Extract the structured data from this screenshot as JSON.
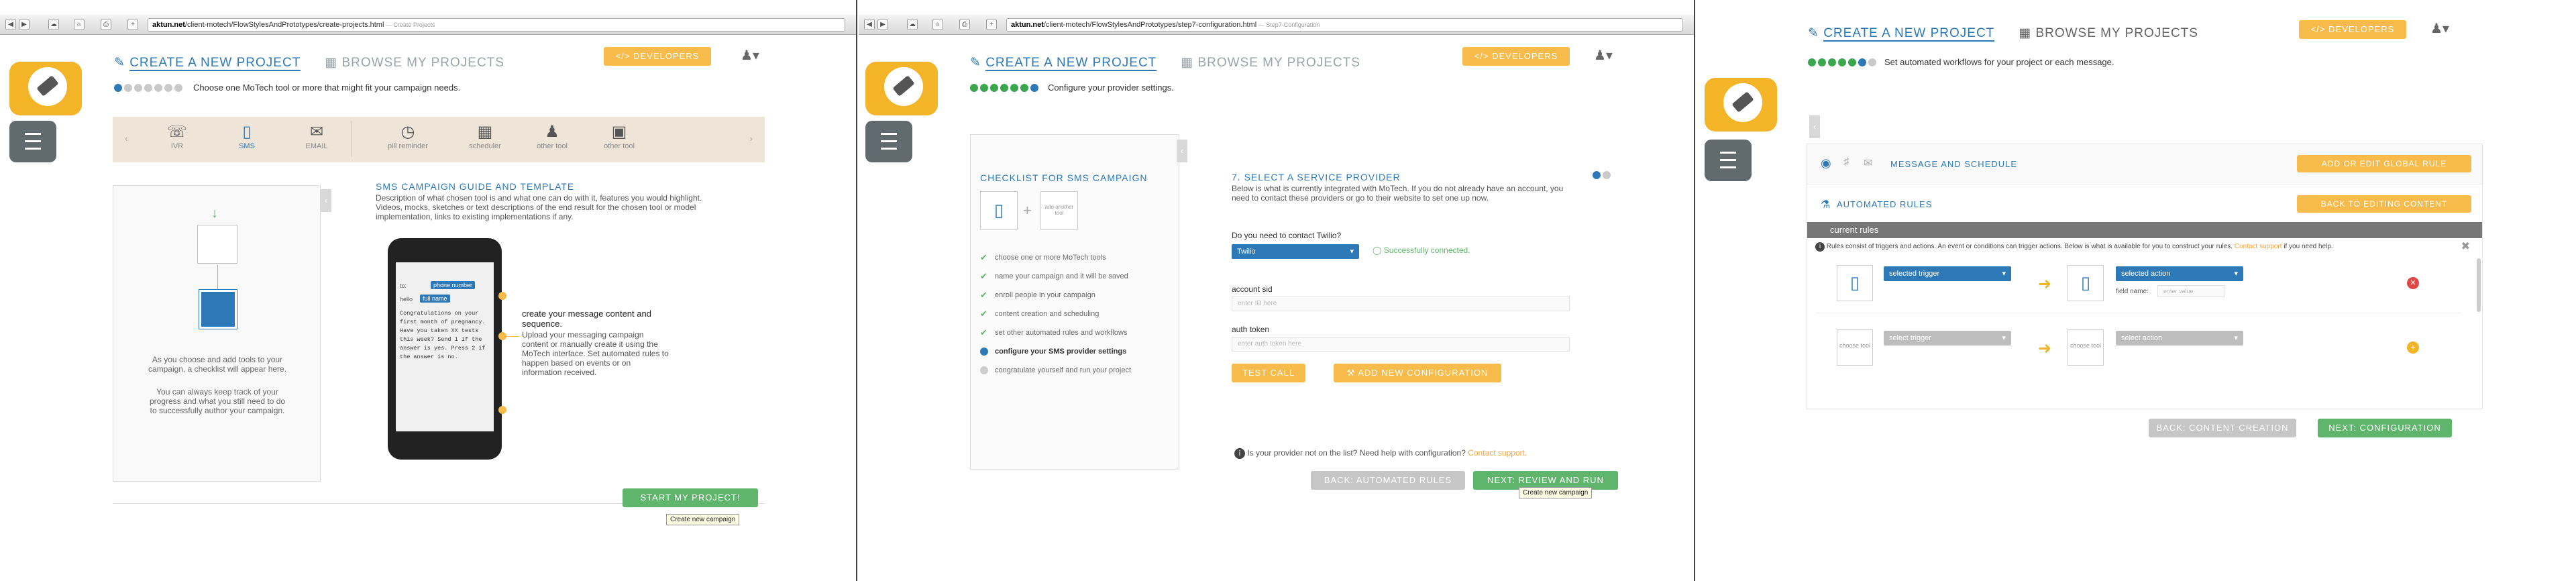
{
  "common": {
    "create_tab": "CREATE A NEW PROJECT",
    "browse_tab": "BROWSE MY PROJECTS",
    "developers": "</> DEVELOPERS",
    "browser_nav": [
      "◀",
      "▶",
      "☁",
      "⌂",
      "⎙",
      "+"
    ]
  },
  "p1": {
    "url_host": "aktun.net",
    "url_path": "/client-motech/FlowStylesAndPrototypes/create-projects.html",
    "url_title": " — Create Projects",
    "subtitle": "Choose one MoTech tool or more that might fit your campaign needs.",
    "tools": [
      {
        "label": "IVR",
        "icon": "phone-volume-icon"
      },
      {
        "label": "SMS",
        "icon": "sms-icon"
      },
      {
        "label": "EMAIL",
        "icon": "envelope-icon"
      },
      {
        "label": "pill reminder",
        "icon": "clock-icon"
      },
      {
        "label": "scheduler",
        "icon": "calendar-icon"
      },
      {
        "label": "other tool",
        "icon": "person-icon"
      },
      {
        "label": "other tool",
        "icon": "briefcase-icon"
      }
    ],
    "checklist_hint1": "As you choose and add tools to your campaign, a checklist will appear here.",
    "checklist_hint2": "You can always keep track of your progress and what you still need to do to successfully author your campaign.",
    "guide_title": "SMS CAMPAIGN GUIDE AND TEMPLATE",
    "guide_text": "Description of what chosen tool is and what one can do with it, features you would highlight. Videos, mocks, sketches or text descriptions of the end result for the chosen tool or model implementation, links to existing implementations if any.",
    "phone_tags": [
      "phone number",
      "full name"
    ],
    "phone_text": "Congratulations on your first month of pregnancy. Have you taken XX tests this week? Send 1 if the answer is yes. Press 2 if the answer is no.",
    "callout_title": "create your message content and sequence.",
    "callout_text": "Upload your messaging campaign content or manually create it using the MoTech interface. Set automated rules to happen based on events or on information received.",
    "start_button": "START MY PROJECT!",
    "tooltip": "Create new campaign"
  },
  "p2": {
    "url_host": "aktun.net",
    "url_path": "/client-motech/FlowStylesAndPrototypes/step7-configuration.html",
    "url_title": " — Step7-Configuration",
    "subtitle": "Configure your provider settings.",
    "checklist_title": "CHECKLIST FOR SMS CAMPAIGN",
    "add_another": "add another tool",
    "checklist": [
      {
        "label": "choose one or more MoTech tools",
        "state": "done"
      },
      {
        "label": "name your campaign and it will be saved",
        "state": "done"
      },
      {
        "label": "enroll people in your campaign",
        "state": "done"
      },
      {
        "label": "content creation and scheduling",
        "state": "done"
      },
      {
        "label": "set other automated rules and workflows",
        "state": "done"
      },
      {
        "label": "configure your SMS provider settings",
        "state": "current"
      },
      {
        "label": "congratulate yourself and run your project",
        "state": "pending"
      }
    ],
    "step_title": "7. SELECT A SERVICE PROVIDER",
    "step_text": "Below is what is currently integrated with MoTech. If you do not already have an account, you need to contact these providers or go to their website to set one up now.",
    "contact_q": "Do you need to contact Twilio?",
    "provider": "Twilio",
    "connected": "Successfully connected.",
    "sid_label": "account sid",
    "sid_placeholder": "enter ID here",
    "token_label": "auth token",
    "token_placeholder": "enter auth token here",
    "test_call": "TEST CALL",
    "add_config": "ADD NEW CONFIGURATION",
    "help_q": "Is your provider not on the list? Need help with configuration?",
    "help_link": "Contact support.",
    "back_button": "BACK: AUTOMATED RULES",
    "next_button": "NEXT: REVIEW AND RUN",
    "tooltip": "Create new campaign"
  },
  "p3": {
    "subtitle": "Set automated workflows for your project or each message.",
    "message_schedule": "MESSAGE AND SCHEDULE",
    "add_global": "ADD OR EDIT GLOBAL RULE",
    "automated_rules": "AUTOMATED RULES",
    "back_editing": "BACK TO EDITING CONTENT",
    "current_rules": "current rules",
    "rules_info": "Rules consist of triggers and actions. An event or conditions can trigger actions. Below is what is available for you to construct your rules.",
    "rules_link": "Contact support",
    "rules_info2": "if you need help.",
    "selected_trigger": "selected trigger",
    "selected_action": "selected action",
    "field_name": "field name:",
    "field_placeholder": "enter value",
    "select_trigger": "select trigger",
    "select_action": "select action",
    "choose_tool": "choose tool",
    "back_button": "BACK: CONTENT CREATION",
    "next_button": "NEXT: CONFIGURATION"
  }
}
